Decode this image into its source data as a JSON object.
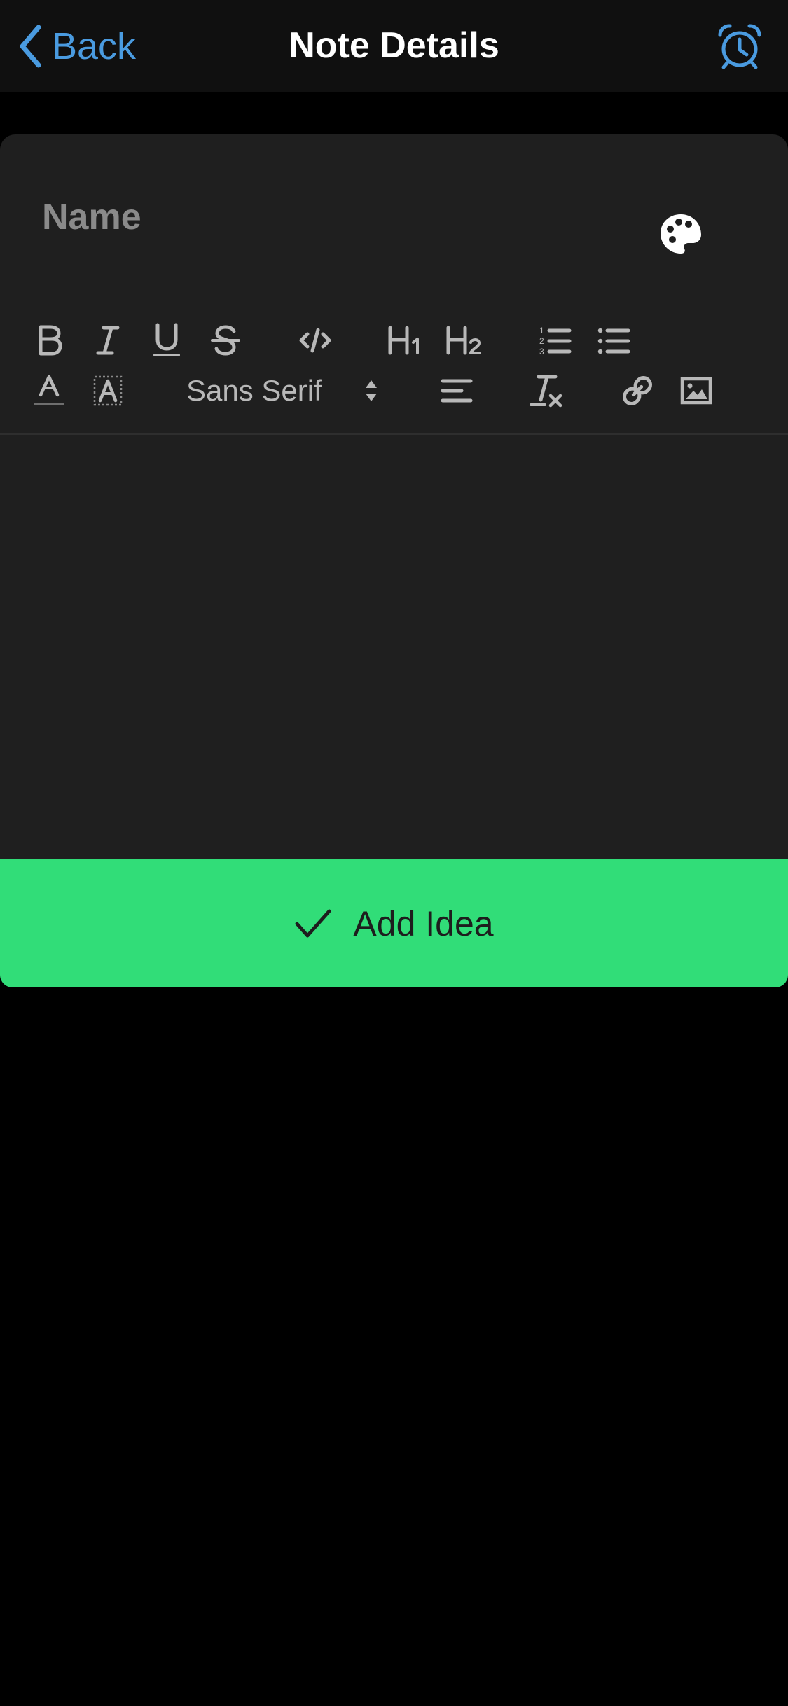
{
  "header": {
    "title": "Note Details",
    "back_label": "Back",
    "back_icon": "chevron-left-icon",
    "alarm_icon": "alarm-clock-icon"
  },
  "note": {
    "name_value": "",
    "name_placeholder": "Name",
    "palette_icon": "palette-icon",
    "body_value": ""
  },
  "toolbar": {
    "row1": [
      "bold",
      "italic",
      "underline",
      "strikethrough",
      "code-block",
      "heading-1",
      "heading-2",
      "ordered-list",
      "bullet-list"
    ],
    "row2": [
      "font-color",
      "background-color",
      "font-family",
      "align",
      "clear-formatting",
      "link",
      "image"
    ],
    "font_family_value": "Sans Serif"
  },
  "action": {
    "add_label": "Add Idea",
    "add_icon": "checkmark-icon"
  },
  "colors": {
    "accent_blue": "#4a9be0",
    "action_green": "#31dd78",
    "card_background": "#1f1f1f",
    "header_background": "#101010",
    "page_background": "#000000",
    "toolbar_icon": "#b8b8b8"
  }
}
